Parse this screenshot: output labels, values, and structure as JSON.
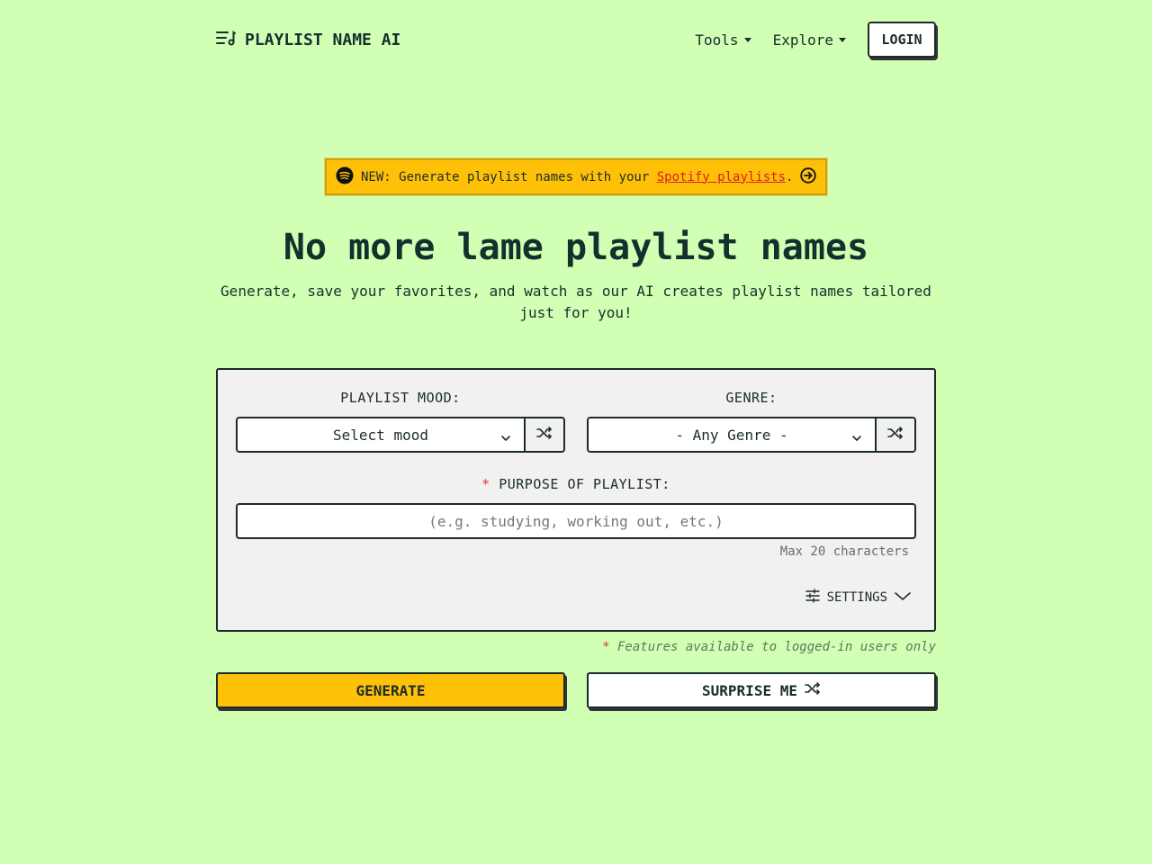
{
  "header": {
    "brand": "PLAYLIST NAME AI",
    "nav": [
      {
        "label": "Tools"
      },
      {
        "label": "Explore"
      }
    ],
    "login_label": "LOGIN"
  },
  "banner": {
    "prefix": "NEW: Generate playlist names with your ",
    "link_text": "Spotify playlists",
    "suffix": "."
  },
  "hero": {
    "title": "No more lame playlist names",
    "subtitle": "Generate, save your favorites, and watch as our AI creates playlist names tailored just for you!"
  },
  "form": {
    "mood_label": "PLAYLIST MOOD:",
    "mood_value": "Select mood",
    "genre_label": "GENRE:",
    "genre_value": "- Any Genre -",
    "purpose_required_mark": "*",
    "purpose_label": "PURPOSE OF PLAYLIST:",
    "purpose_placeholder": "(e.g. studying, working out, etc.)",
    "purpose_value": "",
    "hint": "Max 20 characters",
    "settings_label": "SETTINGS"
  },
  "footnote": {
    "mark": "*",
    "text": " Features available to logged-in users only"
  },
  "actions": {
    "generate_label": "GENERATE",
    "surprise_label": "SURPRISE ME"
  },
  "colors": {
    "background": "#d1ffb3",
    "accent": "#ffc108",
    "text": "#14302e",
    "link": "#d42020",
    "required": "#e03a2f"
  }
}
